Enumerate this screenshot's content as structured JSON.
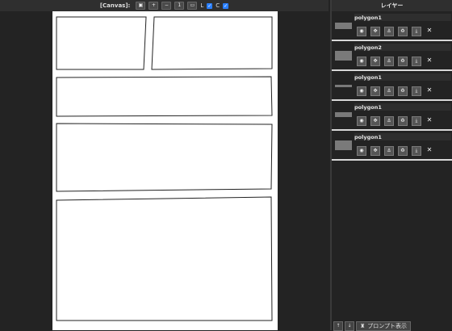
{
  "toolbar": {
    "label": "[Canvas]:",
    "buttons": [
      {
        "name": "image-icon",
        "glyph": "▣"
      },
      {
        "name": "zoom-in-icon",
        "glyph": "⊕"
      },
      {
        "name": "zoom-out-icon",
        "glyph": "⊖"
      },
      {
        "name": "fit-1-icon",
        "glyph": "1"
      },
      {
        "name": "fit-screen-icon",
        "glyph": "▭"
      }
    ],
    "l_label": "L",
    "c_label": "C",
    "l_checked": true,
    "c_checked": true
  },
  "panel": {
    "title": "レイヤー"
  },
  "layers": [
    {
      "name": "polygon1",
      "thumb": "wide"
    },
    {
      "name": "polygon2",
      "thumb": "square"
    },
    {
      "name": "polygon1",
      "thumb": "thin"
    },
    {
      "name": "polygon1",
      "thumb": "mid"
    },
    {
      "name": "polygon1",
      "thumb": "square"
    }
  ],
  "layer_icons": [
    "eye-icon",
    "move-icon",
    "anchor-icon",
    "recycle-icon",
    "download-icon",
    "close-icon"
  ],
  "bottom": {
    "up": "↑",
    "down": "↓",
    "prompt_label": "プロンプト表示"
  }
}
